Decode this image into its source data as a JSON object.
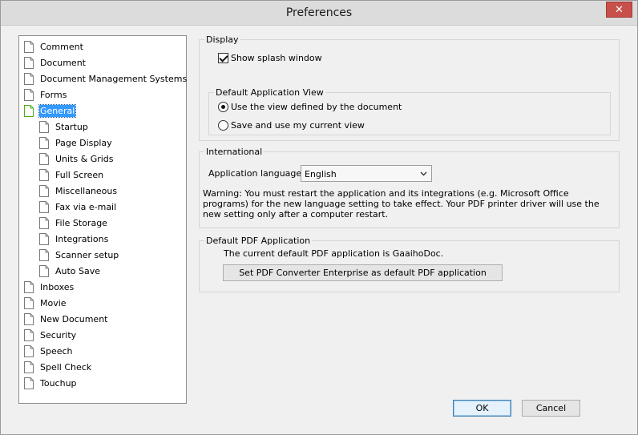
{
  "window": {
    "title": "Preferences",
    "close_glyph": "✕"
  },
  "tree": {
    "items": [
      {
        "label": "Comment"
      },
      {
        "label": "Document"
      },
      {
        "label": "Document Management Systems"
      },
      {
        "label": "Forms"
      },
      {
        "label": "General",
        "selected": true
      },
      {
        "label": "Startup"
      },
      {
        "label": "Page Display"
      },
      {
        "label": "Units & Grids"
      },
      {
        "label": "Full Screen"
      },
      {
        "label": "Miscellaneous"
      },
      {
        "label": "Fax via e-mail"
      },
      {
        "label": "File Storage"
      },
      {
        "label": "Integrations"
      },
      {
        "label": "Scanner setup"
      },
      {
        "label": "Auto Save"
      },
      {
        "label": "Inboxes"
      },
      {
        "label": "Movie"
      },
      {
        "label": "New Document"
      },
      {
        "label": "Security"
      },
      {
        "label": "Speech"
      },
      {
        "label": "Spell Check"
      },
      {
        "label": "Touchup"
      }
    ]
  },
  "display": {
    "title": "Display",
    "show_splash": {
      "label": "Show splash window",
      "checked": true
    },
    "default_view": {
      "title": "Default Application View",
      "option_document": {
        "label": "Use the view defined by the document",
        "selected": true
      },
      "option_current": {
        "label": "Save and use my current view",
        "selected": false
      }
    }
  },
  "international": {
    "title": "International",
    "language_label": "Application language:",
    "language_value": "English",
    "warning": "Warning: You must restart the application and its integrations (e.g. Microsoft Office programs) for the new language setting to take effect. Your PDF printer driver will use the new setting only after a computer restart."
  },
  "default_pdf": {
    "title": "Default PDF Application",
    "current_text": "The current default PDF application is GaaihoDoc.",
    "set_button": "Set PDF Converter Enterprise as default PDF application"
  },
  "footer": {
    "ok": "OK",
    "cancel": "Cancel"
  },
  "colors": {
    "selection": "#3399ff",
    "selected_icon": "#4caf1e"
  }
}
